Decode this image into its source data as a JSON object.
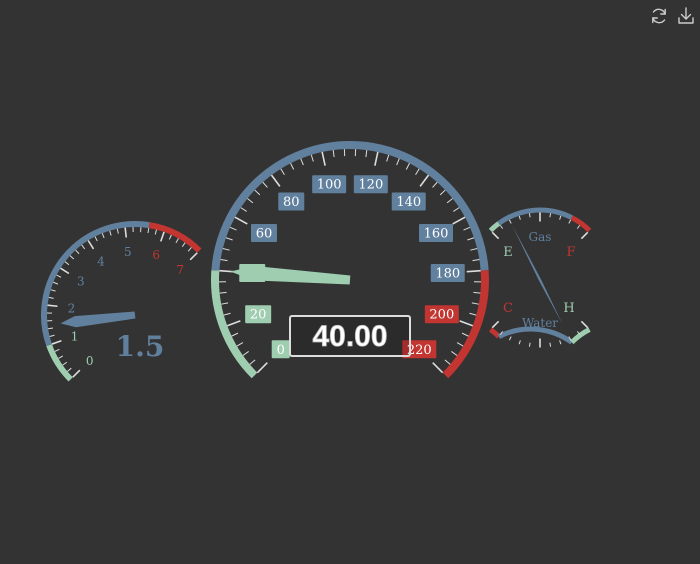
{
  "toolbar": {
    "restore_icon": "refresh-icon",
    "download_icon": "download-icon"
  },
  "colors": {
    "background": "#333333",
    "blue": "#61809e",
    "green": "#9fcdb0",
    "red": "#c23531",
    "tick": "#dddddd",
    "readout_border": "#dddddd"
  },
  "chart_data": [
    {
      "type": "gauge",
      "name": "speed",
      "min": 0,
      "max": 220,
      "value": 40,
      "detail": "40.00",
      "labels": [
        "0",
        "20",
        "40",
        "60",
        "80",
        "100",
        "120",
        "140",
        "160",
        "180",
        "200",
        "220"
      ],
      "bands": [
        {
          "to": 40,
          "color": "#9fcdb0"
        },
        {
          "to": 180,
          "color": "#61809e"
        },
        {
          "to": 220,
          "color": "#c23531"
        }
      ]
    },
    {
      "type": "gauge",
      "name": "rpm",
      "min": 0,
      "max": 7,
      "value": 1.5,
      "detail": "1.5",
      "labels": [
        "0",
        "1",
        "2",
        "3",
        "4",
        "5",
        "6",
        "7"
      ],
      "bands": [
        {
          "to": 1,
          "color": "#9fcdb0"
        },
        {
          "to": 5.6,
          "color": "#61809e"
        },
        {
          "to": 7,
          "color": "#c23531"
        }
      ]
    },
    {
      "type": "gauge",
      "name": "fuel",
      "min": 0,
      "max": 2,
      "value": 0.5,
      "title": "Gas",
      "labels": [
        "E",
        "F"
      ],
      "bands": [
        {
          "to": 0.2,
          "color": "#9fcdb0"
        },
        {
          "to": 1.6,
          "color": "#61809e"
        },
        {
          "to": 2,
          "color": "#c23531"
        }
      ]
    },
    {
      "type": "gauge",
      "name": "temperature",
      "min": 0,
      "max": 2,
      "value": 0.5,
      "title": "Water",
      "labels": [
        "C",
        "H"
      ],
      "bands": [
        {
          "to": 0.2,
          "color": "#c23531"
        },
        {
          "to": 1.6,
          "color": "#61809e"
        },
        {
          "to": 2,
          "color": "#9fcdb0"
        }
      ]
    }
  ]
}
